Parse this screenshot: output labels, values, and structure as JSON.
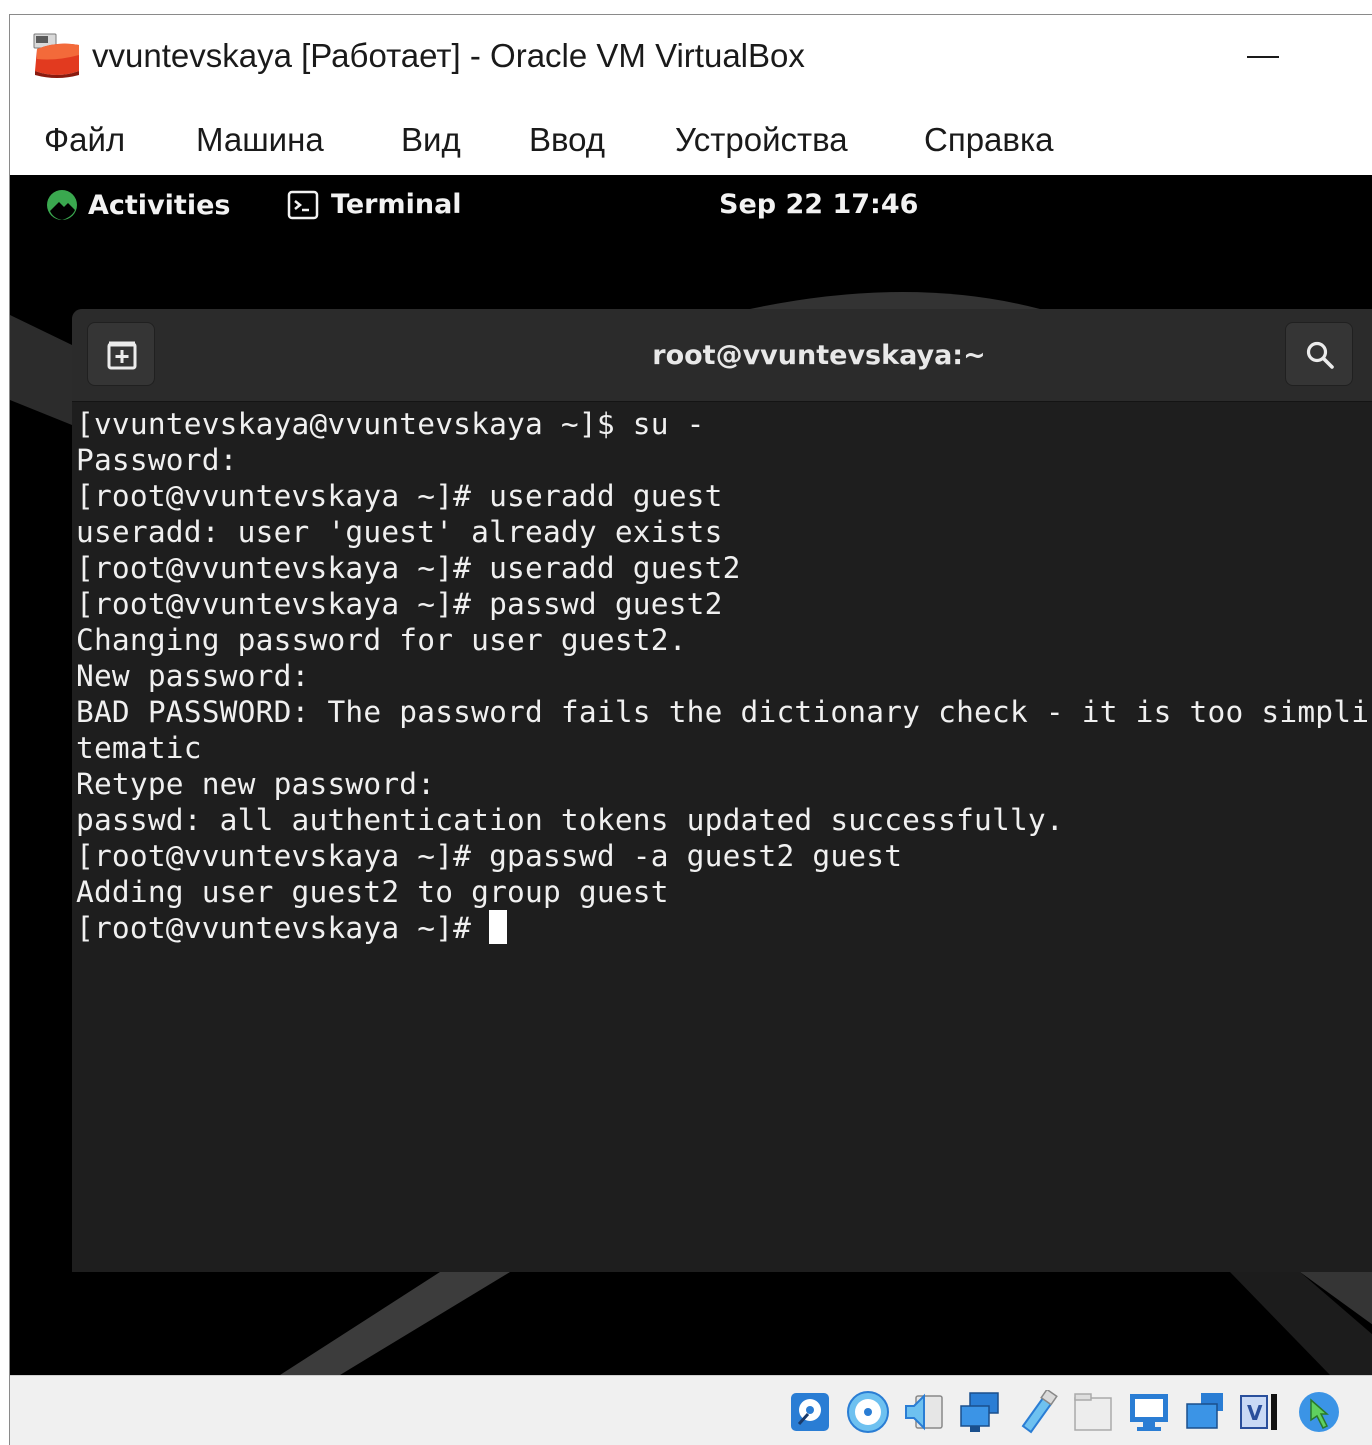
{
  "window": {
    "title": "vvuntevskaya [Работает] - Oracle VM VirtualBox",
    "minimize_label": ""
  },
  "menubar": {
    "items": [
      {
        "label": "Файл"
      },
      {
        "label": "Машина"
      },
      {
        "label": "Вид"
      },
      {
        "label": "Ввод"
      },
      {
        "label": "Устройства"
      },
      {
        "label": "Справка"
      }
    ]
  },
  "gnome_topbar": {
    "activities_label": "Activities",
    "app_label": "Terminal",
    "clock": "Sep 22  17:46"
  },
  "terminal": {
    "title": "root@vvuntevskaya:~",
    "lines": [
      "[vvuntevskaya@vvuntevskaya ~]$ su -",
      "Password:",
      "[root@vvuntevskaya ~]# useradd guest",
      "useradd: user 'guest' already exists",
      "[root@vvuntevskaya ~]# useradd guest2",
      "[root@vvuntevskaya ~]# passwd guest2",
      "Changing password for user guest2.",
      "New password:",
      "BAD PASSWORD: The password fails the dictionary check - it is too simplistic/sys",
      "tematic",
      "Retype new password:",
      "passwd: all authentication tokens updated successfully.",
      "[root@vvuntevskaya ~]# gpasswd -a guest2 guest",
      "Adding user guest2 to group guest"
    ],
    "prompt": "[root@vvuntevskaya ~]# "
  },
  "statusbar": {
    "icons": [
      "hard-disk-icon",
      "optical-drive-icon",
      "audio-icon",
      "network-icon",
      "usb-icon",
      "shared-folders-icon",
      "display-icon",
      "video-capture-icon",
      "virtualization-icon",
      "mouse-integration-icon"
    ]
  },
  "colors": {
    "guest_background": "#000000",
    "terminal_background": "#1e1e1e",
    "terminal_header": "#2b2b2b",
    "terminal_text": "#f0f0f0",
    "activities_green": "#3aa84f"
  }
}
